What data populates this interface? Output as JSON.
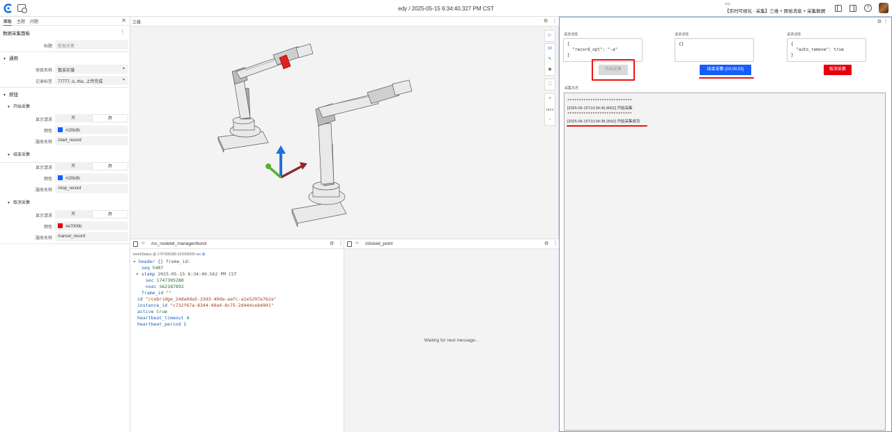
{
  "topbar": {
    "title": "edy / 2025-05-15 6:34:40.327 PM CST",
    "layout_label": "布局",
    "layout_name": "【实时可视化 - 采集】三维 + 原始消息 + 采集数据"
  },
  "left_panel": {
    "tabs": [
      "面板",
      "主题",
      "问题"
    ],
    "panel_title": "数据采集面板",
    "title_label": "标题",
    "title_placeholder": "数据采集",
    "general_section": "通用",
    "project_label": "项目名称",
    "project_value": "数采实操",
    "record_tag_label": "记录标签",
    "record_tag_value": "77777, is, this, 上传完成",
    "buttons_section": "按钮",
    "toggle_off": "关",
    "toggle_on": "开",
    "show_request_label": "显示请求",
    "color_label": "颜色",
    "service_label": "服务名称",
    "groups": [
      {
        "name": "开始采集",
        "color_hex": "#155dfc",
        "color_swatch": "#155dfc",
        "service": "/start_record"
      },
      {
        "name": "结束采集",
        "color_hex": "#155dfc",
        "color_swatch": "#155dfc",
        "service": "/stop_record"
      },
      {
        "name": "取消采集",
        "color_hex": "#e7000b",
        "color_swatch": "#e7000b",
        "service": "/cancel_record"
      }
    ]
  },
  "view3d": {
    "title": "三维",
    "tools": {
      "mode_3d": "3D",
      "zoom_percent": "191%",
      "zoom_in": "+",
      "zoom_out": "−"
    }
  },
  "right_panel": {
    "request_label": "请求详情",
    "requests": [
      "{\n  \"record_opt\": \"-a\"\n}",
      "{}",
      "{\n  \"auto_remove\": true\n}"
    ],
    "start_button": "开始采集",
    "stop_button": "结束采集 (00:00:03)",
    "cancel_button": "取消采集",
    "log_label": "采集日志",
    "log_lines": [
      "****************************",
      "[2025-05-15T10:34:36.806Z] 开始采集",
      "****************************",
      "[2025-05-15T10:34:38.269Z] 开始采集成功"
    ],
    "colors": {
      "start_disabled": "#d9d9d9",
      "stop": "#155dfc",
      "cancel": "#e7000b",
      "annotation": "#e11111"
    }
  },
  "bond_panel": {
    "topic": "/co_nodelet_manager/bond",
    "meta": "bond/Status @ 1747305280.322000000 sec",
    "header_key": "header",
    "header_braces": "{}",
    "frame_id_inline": "frame_id:",
    "seq_key": "seq",
    "seq_val": "5407",
    "stamp_key": "stamp",
    "stamp_time": "2025-05-15 6:34:40.562 PM CST",
    "sec_key": "sec",
    "sec_val": "1747305280",
    "nsec_key": "nsec",
    "nsec_val": "562187892",
    "frame_id_key": "frame_id",
    "frame_id_val": "\"\"",
    "id_key": "id",
    "id_val": "\"/cobridge_24da0da5-23d3-49da-aafc-a1e5297e762a\"",
    "instance_key": "instance_id",
    "instance_val": "\"c732f67a-8344-49a4-8c75-2d444ceb4991\"",
    "active_key": "active",
    "active_val": "true",
    "hb_timeout_key": "heartbeat_timeout",
    "hb_timeout_val": "4",
    "hb_period_key": "heartbeat_period",
    "hb_period_val": "1"
  },
  "clicked_panel": {
    "topic": "/clicked_point",
    "waiting": "Waiting for next message..."
  }
}
